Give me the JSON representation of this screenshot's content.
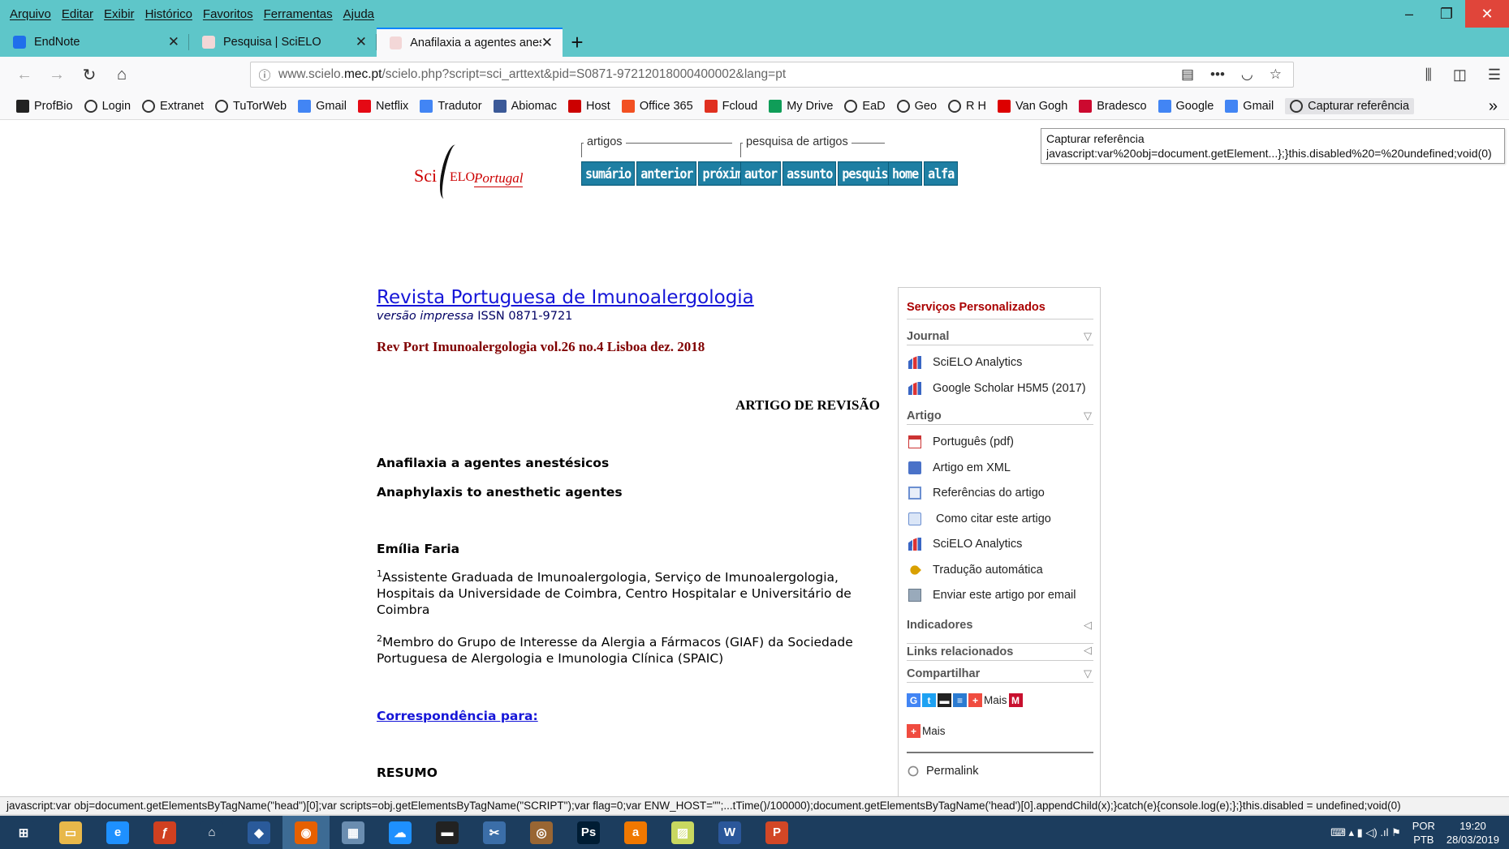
{
  "menu": [
    "Arquivo",
    "Editar",
    "Exibir",
    "Histórico",
    "Favoritos",
    "Ferramentas",
    "Ajuda"
  ],
  "window_controls": {
    "minimize": "–",
    "restore": "❐",
    "close": "✕"
  },
  "tabs": [
    {
      "title": "EndNote",
      "icon_color": "#1f6feb",
      "active": false
    },
    {
      "title": "Pesquisa | SciELO",
      "icon_color": "#c00",
      "active": false
    },
    {
      "title": "Anafilaxia a agentes anestésico",
      "icon_color": "#c00",
      "active": true
    }
  ],
  "tab_close": "✕",
  "new_tab": "+",
  "address": {
    "prefix": "www.scielo.",
    "domain": "mec.pt",
    "rest": "/scielo.php?script=sci_arttext&pid=S0871-97212018000400002&lang=pt"
  },
  "nav_icons": {
    "back": "←",
    "forward": "→",
    "reload": "↻",
    "home": "⌂",
    "info": "ⓘ",
    "reader": "▤",
    "more": "•••",
    "pocket": "◡",
    "star": "☆",
    "library": "⫼",
    "sidebar": "◫",
    "menu": "☰"
  },
  "bookmarks": [
    {
      "label": "ProfBio",
      "icon": "half-circle-icon",
      "color": "#222"
    },
    {
      "label": "Login",
      "icon": "globe-icon",
      "color": ""
    },
    {
      "label": "Extranet",
      "icon": "globe-icon",
      "color": ""
    },
    {
      "label": "TuTorWeb",
      "icon": "globe-icon",
      "color": ""
    },
    {
      "label": "Gmail",
      "icon": "google-icon",
      "color": "#4285f4"
    },
    {
      "label": "Netflix",
      "icon": "netflix-icon",
      "color": "#e50914"
    },
    {
      "label": "Tradutor",
      "icon": "translate-icon",
      "color": "#4285f4"
    },
    {
      "label": "Abiomac",
      "icon": "facebook-icon",
      "color": "#3b5998"
    },
    {
      "label": "Host",
      "icon": "r-icon",
      "color": "#c00"
    },
    {
      "label": "Office 365",
      "icon": "office-icon",
      "color": "#f25022"
    },
    {
      "label": "Fcloud",
      "icon": "fcloud-icon",
      "color": "#e03020"
    },
    {
      "label": "My Drive",
      "icon": "drive-icon",
      "color": "#0f9d58"
    },
    {
      "label": "EaD",
      "icon": "globe-icon",
      "color": ""
    },
    {
      "label": "Geo",
      "icon": "globe-icon",
      "color": ""
    },
    {
      "label": "R H",
      "icon": "globe-icon",
      "color": ""
    },
    {
      "label": "Van Gogh",
      "icon": "vangogh-icon",
      "color": "#d00"
    },
    {
      "label": "Bradesco",
      "icon": "bradesco-icon",
      "color": "#cc092f"
    },
    {
      "label": "Google",
      "icon": "google-photos-icon",
      "color": "#4285f4"
    },
    {
      "label": "Gmail",
      "icon": "google-icon",
      "color": "#4285f4"
    },
    {
      "label": "Capturar referência",
      "icon": "globe-icon",
      "color": ""
    }
  ],
  "bookmarks_overflow": "»",
  "tooltip": {
    "line1": "Capturar referência",
    "line2": "javascript:var%20obj=document.getElement...};}this.disabled%20=%20undefined;void(0)"
  },
  "site": {
    "logo_sci": "Sci",
    "logo_elo": "ELO",
    "logo_portugal": "Portugal",
    "groups": [
      {
        "label": "artigos",
        "buttons": [
          "sumário",
          "anterior",
          "próximo"
        ]
      },
      {
        "label": "pesquisa de artigos",
        "buttons": [
          "autor",
          "assunto",
          "pesquisa"
        ]
      },
      {
        "label": "",
        "buttons": [
          "home",
          "alfa"
        ]
      }
    ]
  },
  "article": {
    "journal_title": "Revista Portuguesa de Imunoalergologia",
    "version_label": "versão impressa",
    "issn": "ISSN 0871-9721",
    "volume_line": "Rev Port Imunoalergologia vol.26 no.4 Lisboa dez. 2018",
    "article_type": "ARTIGO DE REVISÃO",
    "title_pt": "Anafilaxia a agentes anestésicos",
    "title_en": "Anaphylaxis to anesthetic agentes",
    "author": "Emília Faria",
    "affiliations": [
      {
        "sup": "1",
        "text": "Assistente Graduada de Imunoalergologia, Serviço de Imunoalergologia, Hospitais da Universidade de Coimbra, Centro Hospitalar e Universitário de Coimbra"
      },
      {
        "sup": "2",
        "text": "Membro do Grupo de Interesse da Alergia a Fármacos (GIAF) da Sociedade Portuguesa de Alergologia e Imunologia Clínica (SPAIC)"
      }
    ],
    "correspondence": "Correspondência para:",
    "abstract_heading": "RESUMO"
  },
  "services": {
    "heading": "Serviços Personalizados",
    "journal_label": "Journal",
    "journal_items": [
      "SciELO Analytics",
      "Google Scholar H5M5 (2017)"
    ],
    "artigo_label": "Artigo",
    "artigo_items": [
      "Português (pdf)",
      "Artigo em XML",
      "Referências do artigo",
      "Como citar este artigo",
      "SciELO Analytics",
      "Tradução automática",
      "Enviar este artigo por email"
    ],
    "indicadores": "Indicadores",
    "links": "Links relacionados",
    "compartilhar": "Compartilhar",
    "mais1": "Mais",
    "mais2": "Mais",
    "permalink": "Permalink",
    "chev_down": "▽",
    "chev_left": "◁"
  },
  "statusbar": "javascript:var obj=document.getElementsByTagName(\"head\")[0];var scripts=obj.getElementsByTagName(\"SCRIPT\");var flag=0;var ENW_HOST=\"\";...tTime()/100000);document.getElementsByTagName('head')[0].appendChild(x);}catch(e){console.log(e);};}this.disabled = undefined;void(0)",
  "taskbar": {
    "lang_line1": "POR",
    "lang_line2": "PTB",
    "time": "19:20",
    "date": "28/03/2019",
    "apps": [
      {
        "name": "start-button",
        "label": "⊞",
        "color": "#1c3d5e"
      },
      {
        "name": "file-explorer-icon",
        "label": "▭",
        "color": "#e8b84a"
      },
      {
        "name": "internet-explorer-icon",
        "label": "e",
        "color": "#1e90ff"
      },
      {
        "name": "flash-icon",
        "label": "ƒ",
        "color": "#d04020"
      },
      {
        "name": "home-icon",
        "label": "⌂",
        "color": "#1c3d5e"
      },
      {
        "name": "bird-app-icon",
        "label": "◆",
        "color": "#2a5a9a"
      },
      {
        "name": "firefox-icon",
        "label": "◉",
        "color": "#e66000"
      },
      {
        "name": "calculator-icon",
        "label": "▦",
        "color": "#6a8db0"
      },
      {
        "name": "onedrive-icon",
        "label": "☁",
        "color": "#1e90ff"
      },
      {
        "name": "printer-icon",
        "label": "▬",
        "color": "#222"
      },
      {
        "name": "snipping-tool-icon",
        "label": "✂",
        "color": "#3b6ea8"
      },
      {
        "name": "media-player-icon",
        "label": "◎",
        "color": "#996633"
      },
      {
        "name": "photoshop-icon",
        "label": "Ps",
        "color": "#001d34"
      },
      {
        "name": "avast-icon",
        "label": "a",
        "color": "#f07800"
      },
      {
        "name": "sticky-notes-icon",
        "label": "▨",
        "color": "#c8d860"
      },
      {
        "name": "word-icon",
        "label": "W",
        "color": "#2b579a"
      },
      {
        "name": "powerpoint-icon",
        "label": "P",
        "color": "#d24726"
      }
    ],
    "tray_icons": "⌨  ▴  ▮ ◁) .ıl ⚑"
  },
  "colors": {
    "accent_tab": "#0a84ff",
    "chrome_bg": "#5ec6c9",
    "scielo_button": "#1e7fa3",
    "journal_link": "#1515d8",
    "volume_text": "#800000",
    "panel_heading": "#aa0000"
  }
}
